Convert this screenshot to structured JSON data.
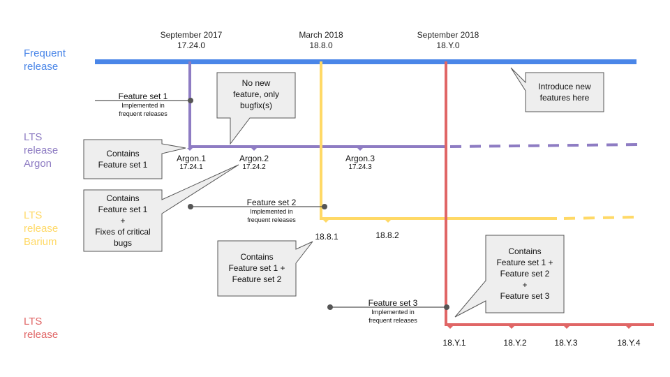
{
  "colors": {
    "frequent": "#4a86e8",
    "argon": "#8e7cc3",
    "barium": "#ffd966",
    "lts": "#e06666",
    "callout_fill": "#eeeeee",
    "callout_stroke": "#555555",
    "connector": "#555555"
  },
  "lanes": [
    {
      "id": "frequent",
      "lines": [
        "Frequent",
        "release"
      ]
    },
    {
      "id": "argon",
      "lines": [
        "LTS",
        "release",
        "Argon"
      ]
    },
    {
      "id": "barium",
      "lines": [
        "LTS",
        "release",
        "Barium"
      ]
    },
    {
      "id": "lts",
      "lines": [
        "LTS",
        "release"
      ]
    }
  ],
  "milestones": [
    {
      "date": "September 2017",
      "version": "17.24.0"
    },
    {
      "date": "March 2018",
      "version": "18.8.0"
    },
    {
      "date": "September 2018",
      "version": "18.Y.0"
    }
  ],
  "argon_releases": [
    {
      "name": "Argon.1",
      "version": "17.24.1"
    },
    {
      "name": "Argon.2",
      "version": "17.24.2"
    },
    {
      "name": "Argon.3",
      "version": "17.24.3"
    }
  ],
  "barium_releases": [
    "18.8.1",
    "18.8.2"
  ],
  "lts_releases": [
    "18.Y.1",
    "18.Y.2",
    "18.Y.3",
    "18.Y.4"
  ],
  "feature_sets": [
    {
      "title": "Feature set 1",
      "sub": [
        "Implemented  in",
        "frequent releases"
      ]
    },
    {
      "title": "Feature set 2",
      "sub": [
        "Implemented  in",
        "frequent releases"
      ]
    },
    {
      "title": "Feature set 3",
      "sub": [
        "Implemented  in",
        "frequent releases"
      ]
    }
  ],
  "callouts": [
    {
      "id": "no-new-feature",
      "lines": [
        "No new",
        "feature, only",
        "bugfix(s)"
      ]
    },
    {
      "id": "introduce-features",
      "lines": [
        "Introduce  new",
        "features  here"
      ]
    },
    {
      "id": "contains-fs1",
      "lines": [
        "Contains",
        "Feature  set  1"
      ]
    },
    {
      "id": "contains-fs1-fixes",
      "lines": [
        "Contains",
        "Feature  set  1",
        "+",
        "Fixes of critical",
        "bugs"
      ]
    },
    {
      "id": "contains-fs1-fs2",
      "lines": [
        "Contains",
        "Feature  set  1  +",
        "Feature  set  2"
      ]
    },
    {
      "id": "contains-fs1-fs2-fs3",
      "lines": [
        "Contains",
        "Feature  set  1  +",
        "Feature  set  2",
        "+",
        "Feature  set  3"
      ]
    }
  ]
}
